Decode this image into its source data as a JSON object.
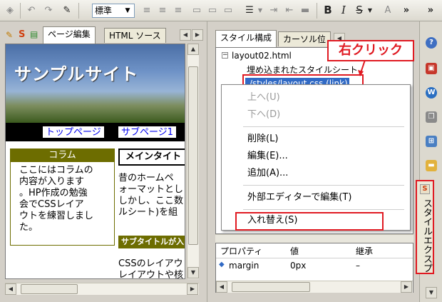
{
  "toolbar": {
    "style_select_value": "標準",
    "bold_label": "B",
    "italic_label": "I",
    "strike_label": "S"
  },
  "left": {
    "tabs": [
      "ページ編集",
      "HTML ソース"
    ],
    "site_title": "サンプルサイト",
    "nav": [
      "トップページ",
      "サブページ1"
    ],
    "column_heading": "コラム",
    "column_lines": [
      "ここにはコラムの",
      "内容が入ります",
      "。HP作成の勉強",
      "会でCSSレイア",
      "ウトを練習しまし",
      "た。"
    ],
    "main_title": "メインタイト",
    "main_lines": [
      "昔のホームペ",
      "ォーマットとし",
      "しかし、ここ数",
      "ルシート)を組"
    ],
    "subtitle": "サブタイトルが入",
    "sub_lines": [
      "CSSのレイアウ",
      "レイアウトや核"
    ]
  },
  "right": {
    "tabs": [
      "スタイル構成",
      "カーソル位"
    ],
    "tree": {
      "root": "layout02.html",
      "embedded": "埋め込まれたスタイルシート",
      "selected": "./styles/layout.css (link)"
    },
    "context_menu": {
      "items": [
        {
          "label": "上へ(U)",
          "enabled": false
        },
        {
          "label": "下へ(D)",
          "enabled": false
        },
        {
          "label": "削除(L)",
          "enabled": true
        },
        {
          "label": "編集(E)...",
          "enabled": true
        },
        {
          "label": "追加(A)...",
          "enabled": true
        },
        {
          "label": "外部エディターで編集(T)",
          "enabled": true
        },
        {
          "label": "入れ替え(S)",
          "enabled": true
        }
      ]
    },
    "props": {
      "headers": [
        "プロパティ",
        "値",
        "継承"
      ],
      "row": {
        "property": "margin",
        "value": "0px",
        "inherit": "–"
      }
    }
  },
  "strip": {
    "vertical_tab": "スタイルエクスプ"
  },
  "annotation": {
    "callout": "右クリック"
  },
  "colors": {
    "accent_red": "#e01a22",
    "selection_blue": "#316ac5",
    "olive": "#6d6d00"
  }
}
